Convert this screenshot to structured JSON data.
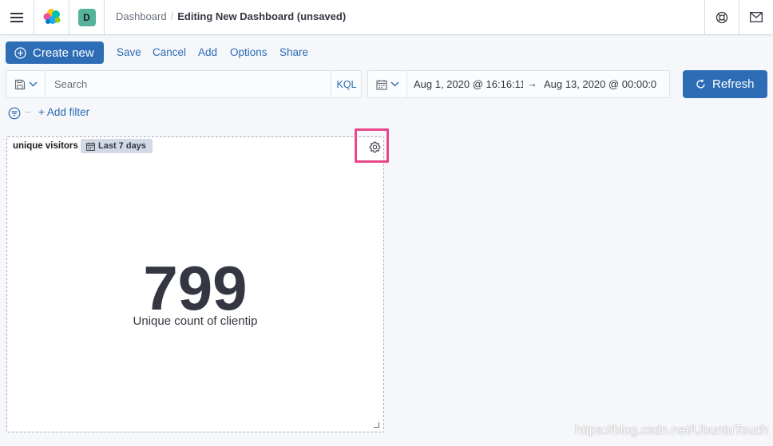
{
  "header": {
    "breadcrumbs": [
      "Dashboard",
      "Editing New Dashboard (unsaved)"
    ],
    "breadcrumb_separator": "/",
    "space_initial": "D",
    "space_color": "#54b399"
  },
  "toolbar": {
    "create_new": "Create new",
    "menu": [
      "Save",
      "Cancel",
      "Add",
      "Options",
      "Share"
    ]
  },
  "query": {
    "placeholder": "Search",
    "value": "",
    "language": "KQL"
  },
  "date_range": {
    "start": "Aug 1, 2020 @ 16:16:11.",
    "end": "Aug 13, 2020 @ 00:00:0",
    "arrow": "→"
  },
  "refresh_label": "Refresh",
  "filter": {
    "add_label": "+ Add filter"
  },
  "panel": {
    "title": "unique visitors",
    "time_badge": "Last 7 days",
    "metric_value": "799",
    "metric_label": "Unique count of clientip"
  },
  "watermark": "https://blog.csdn.net/UbuntuTouch",
  "colors": {
    "primary": "#2d6db5",
    "link": "#2b6bb5",
    "highlight": "#e8488b",
    "text": "#343741"
  },
  "icons": [
    "hamburger-menu-icon",
    "elastic-logo",
    "help-icon",
    "mail-icon",
    "plus-circle-icon",
    "saved-query-icon",
    "chevron-down-icon",
    "calendar-icon",
    "arrow-right-icon",
    "refresh-icon",
    "filter-icon",
    "gear-icon",
    "resize-icon"
  ]
}
